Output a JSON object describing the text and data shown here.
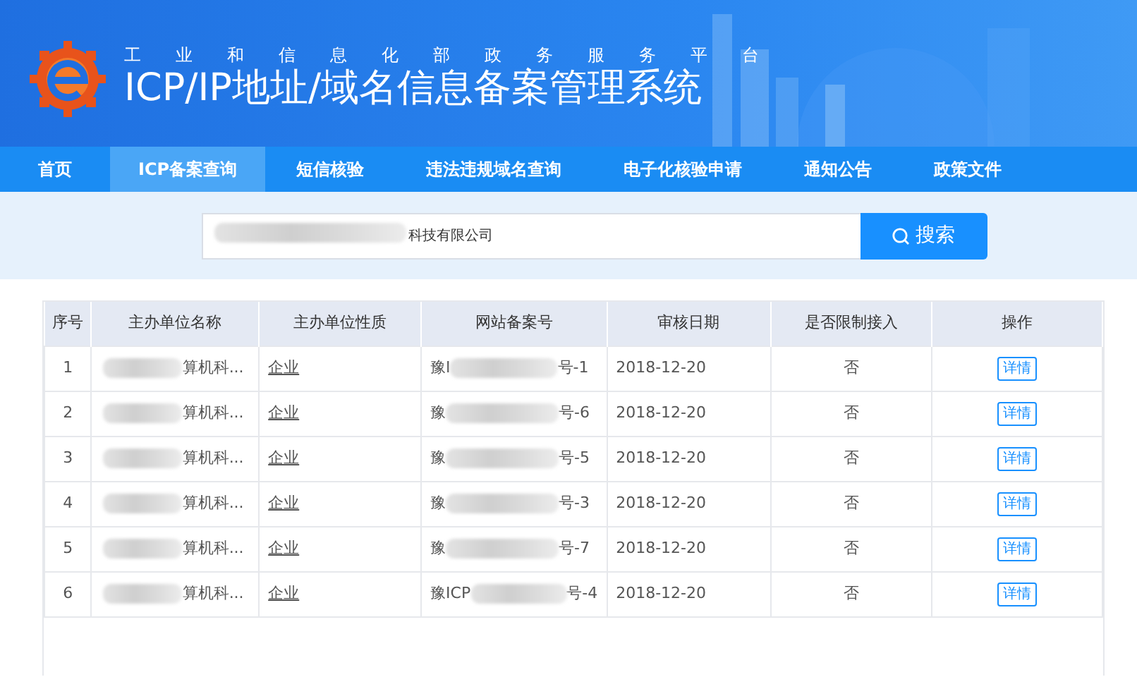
{
  "header": {
    "subtitle": "工业和信息化部政务服务平台",
    "title": "ICP/IP地址/域名信息备案管理系统"
  },
  "nav": [
    {
      "label": "首页",
      "selected": false
    },
    {
      "label": "ICP备案查询",
      "selected": true
    },
    {
      "label": "短信核验",
      "selected": false
    },
    {
      "label": "违法违规域名查询",
      "selected": false
    },
    {
      "label": "电子化核验申请",
      "selected": false
    },
    {
      "label": "通知公告",
      "selected": false
    },
    {
      "label": "政策文件",
      "selected": false
    }
  ],
  "search": {
    "value": "科技有限公司",
    "redacted": true,
    "button": "搜索"
  },
  "table": {
    "columns": [
      "序号",
      "主办单位名称",
      "主办单位性质",
      "网站备案号",
      "审核日期",
      "是否限制接入",
      "操作"
    ],
    "rows": [
      {
        "index": "1",
        "name": "算机科...",
        "type": "企业",
        "record_prefix": "豫I",
        "record_suffix": "号-1",
        "date": "2018-12-20",
        "restricted": "否",
        "action": "详情"
      },
      {
        "index": "2",
        "name": "算机科...",
        "type": "企业",
        "record_prefix": "豫",
        "record_suffix": "号-6",
        "date": "2018-12-20",
        "restricted": "否",
        "action": "详情"
      },
      {
        "index": "3",
        "name": "算机科...",
        "type": "企业",
        "record_prefix": "豫",
        "record_suffix": "号-5",
        "date": "2018-12-20",
        "restricted": "否",
        "action": "详情"
      },
      {
        "index": "4",
        "name": "算机科...",
        "type": "企业",
        "record_prefix": "豫",
        "record_suffix": "号-3",
        "date": "2018-12-20",
        "restricted": "否",
        "action": "详情"
      },
      {
        "index": "5",
        "name": "算机科...",
        "type": "企业",
        "record_prefix": "豫",
        "record_suffix": "号-7",
        "date": "2018-12-20",
        "restricted": "否",
        "action": "详情"
      },
      {
        "index": "6",
        "name": "算机科...",
        "type": "企业",
        "record_prefix": "豫ICP",
        "record_suffix": "号-4",
        "date": "2018-12-20",
        "restricted": "否",
        "action": "详情"
      }
    ]
  }
}
